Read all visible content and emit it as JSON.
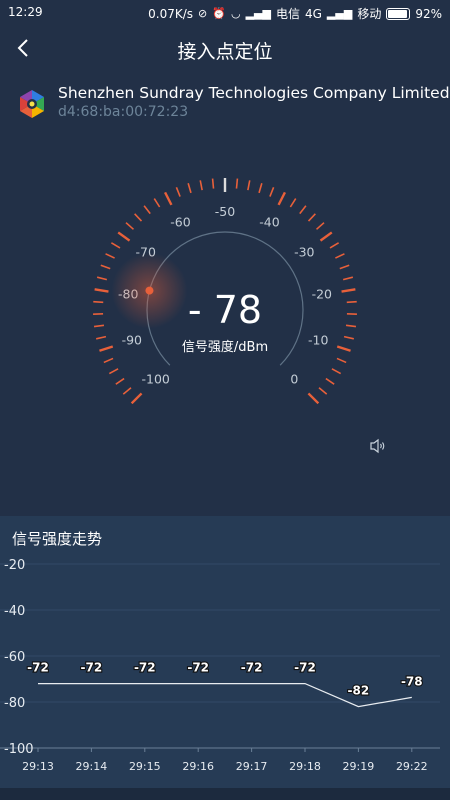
{
  "status_bar": {
    "time": "12:29",
    "speed": "0.07K/s",
    "carrier1": "电信",
    "network": "4G",
    "carrier2": "移动",
    "battery": "92%",
    "battery_level": 0.92
  },
  "header": {
    "title": "接入点定位"
  },
  "device": {
    "name": "Shenzhen Sundray Technologies Company Limited",
    "mac": "d4:68:ba:00:72:23"
  },
  "gauge": {
    "reading": "- 78",
    "value": -78,
    "unit": "信号强度/dBm",
    "scale_labels": [
      "-100",
      "-90",
      "-80",
      "-70",
      "-60",
      "-50",
      "-40",
      "-30",
      "-20",
      "-10",
      "0"
    ],
    "min": -100,
    "max": 0
  },
  "trend": {
    "title": "信号强度走势"
  },
  "chart_data": {
    "type": "line",
    "categories": [
      "29:13",
      "29:14",
      "29:15",
      "29:16",
      "29:17",
      "29:18",
      "29:19",
      "29:22"
    ],
    "values": [
      -72,
      -72,
      -72,
      -72,
      -72,
      -72,
      -82,
      -78
    ],
    "y_ticks": [
      -20,
      -40,
      -60,
      -80,
      -100
    ],
    "ylim": [
      -100,
      -20
    ],
    "grid": true
  },
  "colors": {
    "background": "#223047",
    "panel": "#263b55",
    "accent": "#e8603a",
    "dim_text": "#6d8499"
  }
}
